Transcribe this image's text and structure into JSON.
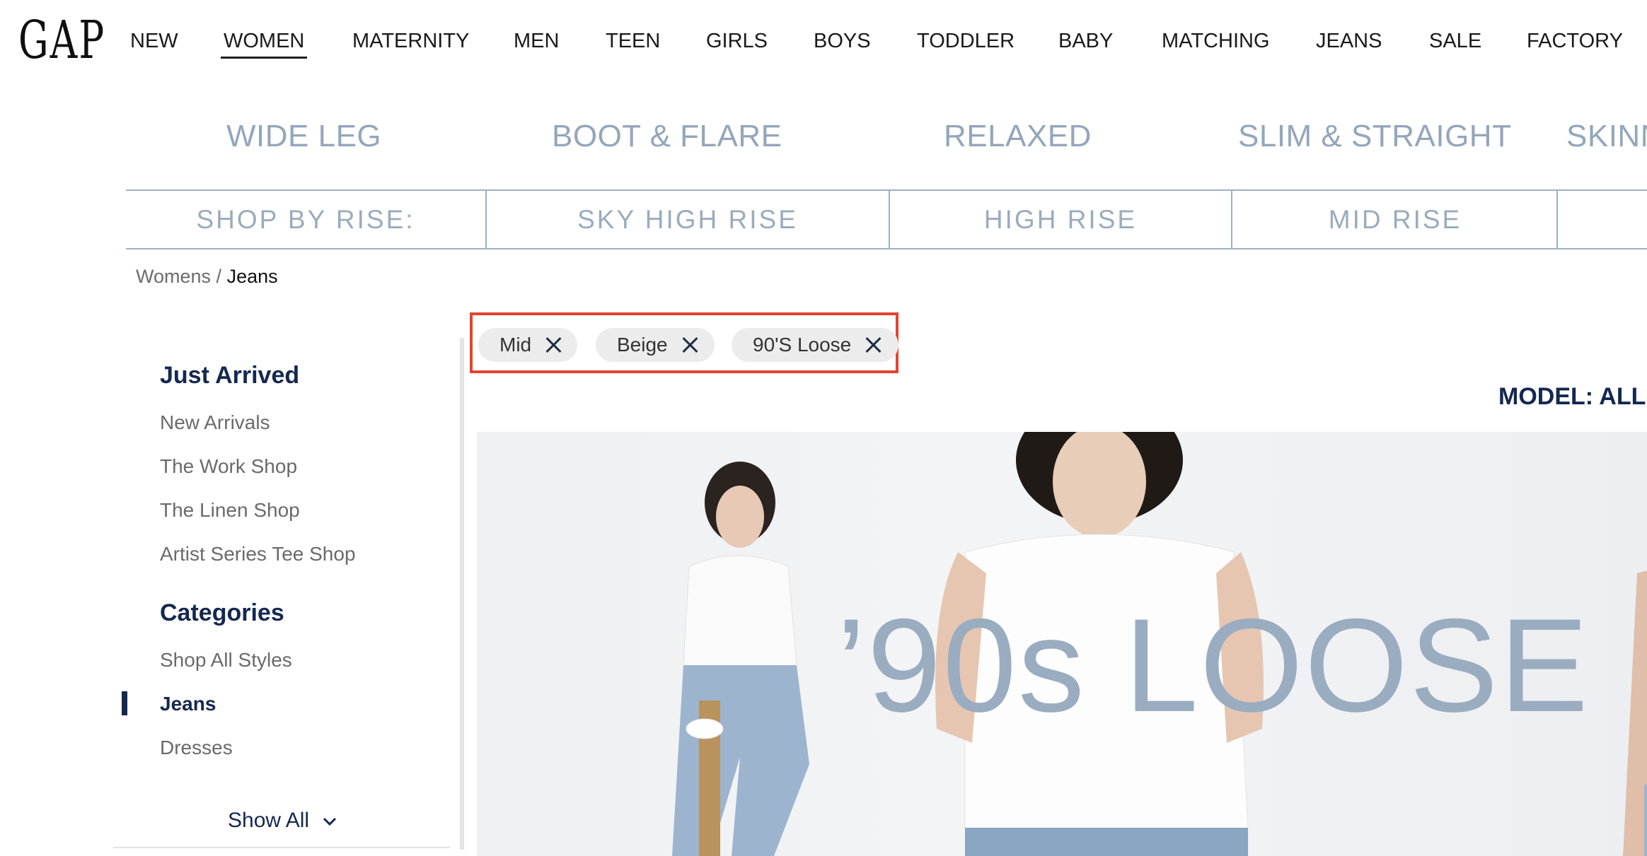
{
  "brand": {
    "logo_text": "GAP"
  },
  "top_nav": {
    "items": [
      "NEW",
      "WOMEN",
      "MATERNITY",
      "MEN",
      "TEEN",
      "GIRLS",
      "BOYS",
      "TODDLER",
      "BABY",
      "MATCHING",
      "JEANS",
      "SALE",
      "FACTORY"
    ],
    "active": "WOMEN"
  },
  "styles": [
    "WIDE LEG",
    "BOOT & FLARE",
    "RELAXED",
    "SLIM & STRAIGHT",
    "SKINN"
  ],
  "rise_bar": {
    "label": "SHOP BY RISE:",
    "options": [
      "SKY HIGH RISE",
      "HIGH RISE",
      "MID RISE"
    ]
  },
  "breadcrumb": {
    "parent": "Womens",
    "separator": " / ",
    "current": "Jeans"
  },
  "sidebar": {
    "just_arrived": {
      "heading": "Just Arrived",
      "links": [
        "New Arrivals",
        "The Work Shop",
        "The Linen Shop",
        "Artist Series Tee Shop"
      ]
    },
    "categories": {
      "heading": "Categories",
      "links": [
        "Shop All Styles",
        "Jeans",
        "Dresses"
      ],
      "active": "Jeans"
    },
    "show_all": "Show All"
  },
  "filters": {
    "chips": [
      "Mid",
      "Beige",
      "90'S Loose"
    ]
  },
  "model_toggle": {
    "label": "MODEL: ALL"
  },
  "hero": {
    "headline": "’90s LOOSE"
  },
  "colors": {
    "navy": "#142850",
    "slate": "#9aacc0",
    "highlight": "#e5432e"
  }
}
